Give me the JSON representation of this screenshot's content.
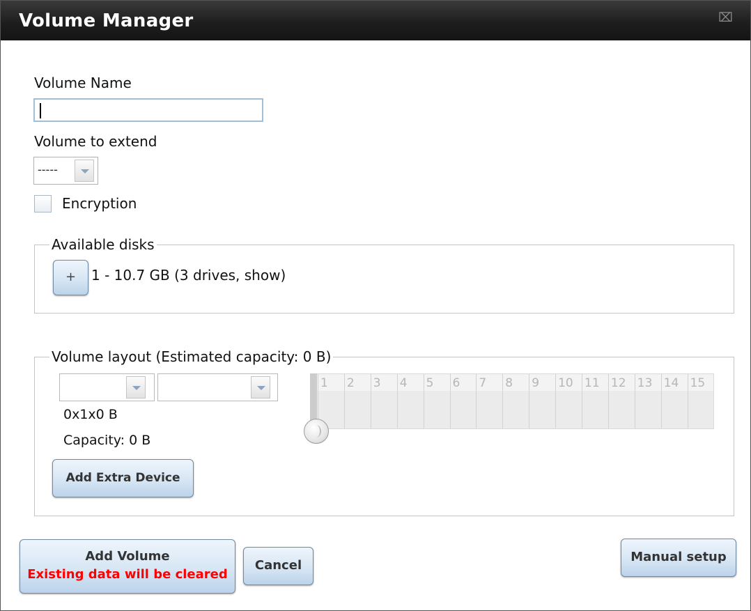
{
  "window": {
    "title": "Volume Manager",
    "close_glyph": "⌧"
  },
  "form": {
    "volume_name_label": "Volume Name",
    "volume_name_value": "",
    "volume_extend_label": "Volume to extend",
    "volume_extend_value": "-----",
    "encryption_label": "Encryption",
    "encryption_checked": false
  },
  "available_disks": {
    "legend": "Available disks",
    "expand_label": "+",
    "disk_summary": "1 - 10.7 GB (3 drives, show)"
  },
  "volume_layout": {
    "legend": "Volume layout (Estimated capacity: 0 B)",
    "layout_type_value": "",
    "layout_size_value": "",
    "geometry_text": "0x1x0 B",
    "capacity_text": "Capacity: 0 B",
    "add_extra_device_label": "Add Extra Device",
    "grid_columns": [
      "1",
      "2",
      "3",
      "4",
      "5",
      "6",
      "7",
      "8",
      "9",
      "10",
      "11",
      "12",
      "13",
      "14",
      "15"
    ]
  },
  "footer": {
    "add_volume_label": "Add Volume",
    "add_volume_warning": "Existing data will be cleared",
    "cancel_label": "Cancel",
    "manual_setup_label": "Manual setup"
  },
  "colors": {
    "warning": "#ff0000",
    "titlebar": "#1e1e1e",
    "button_top": "#eef5fc",
    "button_bottom": "#bcd3ea"
  },
  "icons": {
    "close": "close-icon",
    "dropdown": "chevron-down-icon",
    "slider_knob": "slider-knob-icon"
  }
}
